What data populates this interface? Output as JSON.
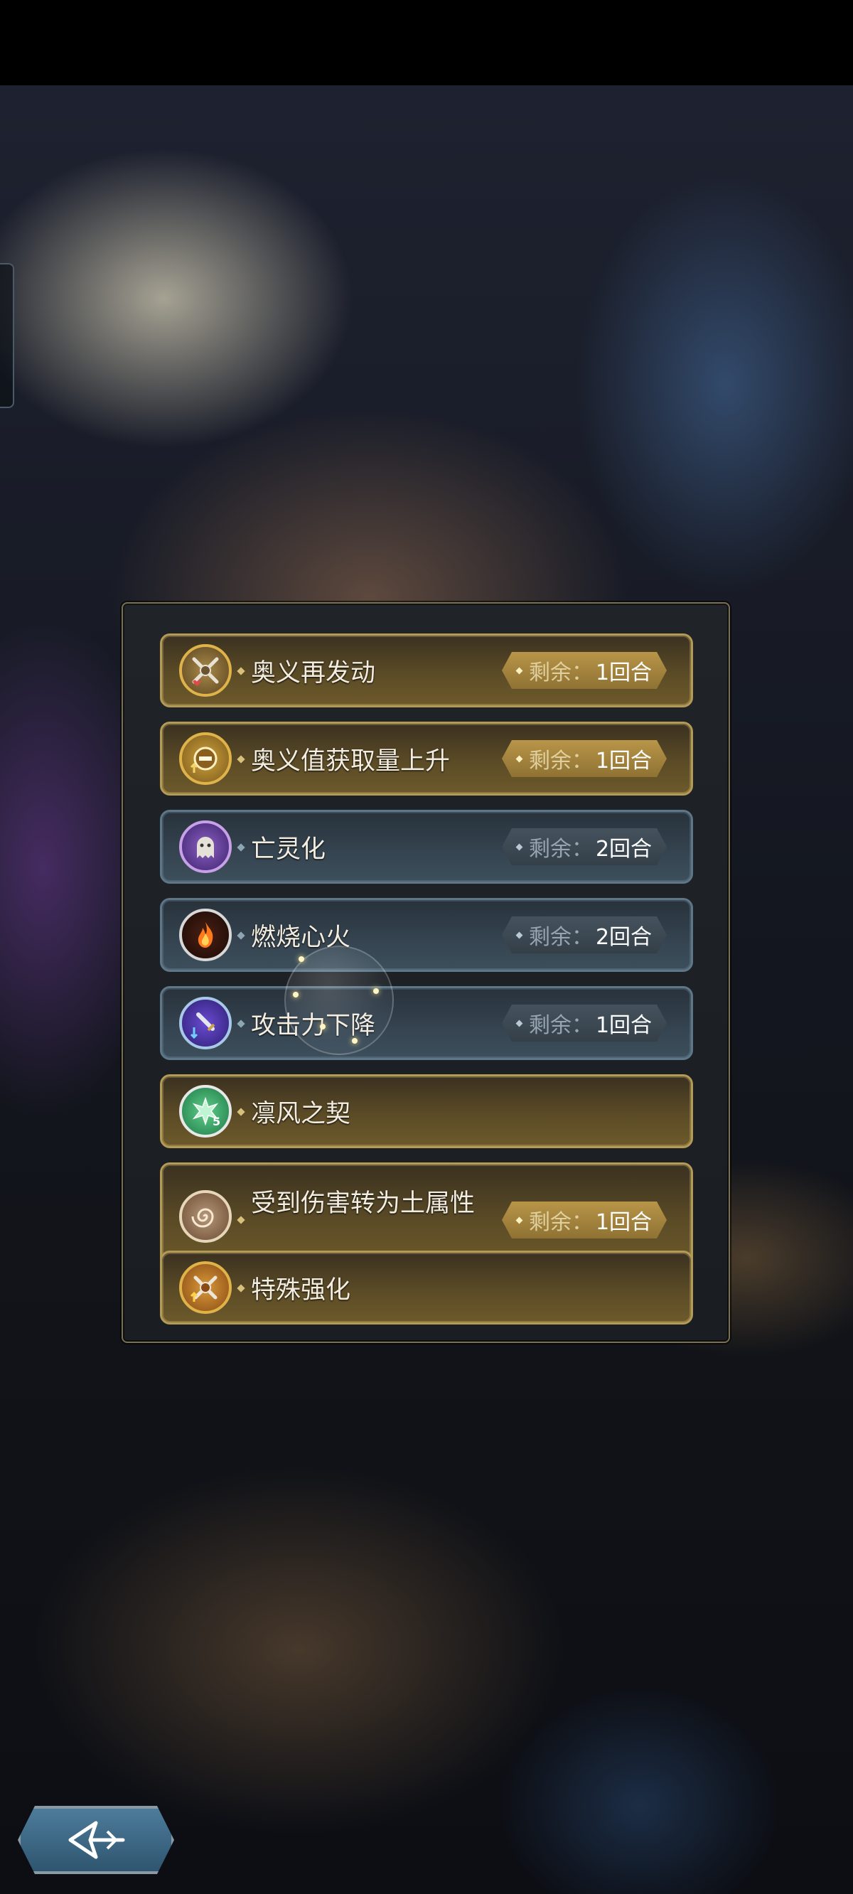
{
  "buff_panel": {
    "items": [
      {
        "name": "奥义再发动",
        "icon": "crossed-swords-heart-icon",
        "remaining_label": "剩余：",
        "remaining_value": "1回合",
        "style": "gold"
      },
      {
        "name": "奥义值获取量上升",
        "icon": "gauge-up-icon",
        "remaining_label": "剩余：",
        "remaining_value": "1回合",
        "style": "gold"
      },
      {
        "name": "亡灵化",
        "icon": "ghost-icon",
        "remaining_label": "剩余：",
        "remaining_value": "2回合",
        "style": "blue"
      },
      {
        "name": "燃烧心火",
        "icon": "flame-icon",
        "remaining_label": "剩余：",
        "remaining_value": "2回合",
        "style": "blue"
      },
      {
        "name": "攻击力下降",
        "icon": "sword-down-icon",
        "remaining_label": "剩余：",
        "remaining_value": "1回合",
        "style": "blue"
      },
      {
        "name": "凛风之契",
        "icon": "wind-burst-5-icon",
        "style": "gold"
      },
      {
        "name": "受到伤害转为土属性",
        "icon": "earth-swirl-icon",
        "remaining_label": "剩余：",
        "remaining_value": "1回合",
        "style": "gold"
      },
      {
        "name": "特殊强化",
        "icon": "crossed-swords-up-icon",
        "style": "gold"
      }
    ]
  },
  "colors": {
    "gold_border": "#b39a55",
    "blue_border": "#5d7788",
    "panel_border": "#7b6f52"
  },
  "back_button": {
    "icon": "back-arrow-icon"
  }
}
